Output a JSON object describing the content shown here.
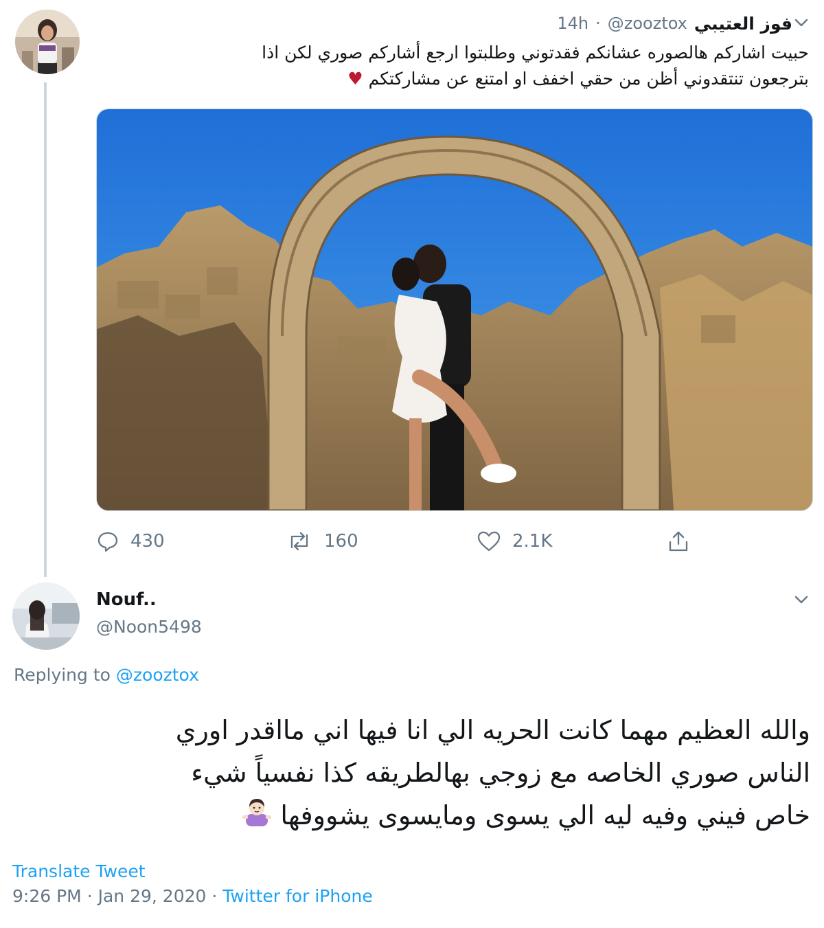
{
  "tweet1": {
    "display_name": "فوز العتيبي",
    "handle": "@zooztox",
    "separator": "·",
    "time": "14h",
    "text_line1": "حبيت اشاركم هالصوره عشانكم فقدتوني وطلبتوا ارجع أشاركم صوري لكن اذا",
    "text_line2": "بترجعون تنتقدوني أظن من حقي اخفف او امتنع عن مشاركتكم",
    "text_emoji": "♥",
    "stats": {
      "replies": "430",
      "retweets": "160",
      "likes": "2.1K"
    }
  },
  "tweet2": {
    "display_name": "Nouf..",
    "handle": "@Noon5498",
    "replying_prefix": "Replying to",
    "replying_mention": "@zooztox",
    "text_line1": "والله العظيم مهما كانت الحريه الي انا فيها اني مااقدر اوري",
    "text_line2": "الناس صوري الخاصه مع زوجي بهالطريقه كذا نفسياً شيء",
    "text_line3": "خاص فيني وفيه ليه الي يسوى ومايسوى يشووفها",
    "text_emoji_icon": "woman-shrugging-icon",
    "translate_label": "Translate Tweet",
    "time": "9:26 PM",
    "meta_sep": "·",
    "date": "Jan 29, 2020",
    "source": "Twitter for iPhone"
  },
  "colors": {
    "link": "#1da1f2",
    "muted": "#657786",
    "text": "#14171a",
    "heart": "#be1931",
    "thread_line": "#ccd6dd"
  }
}
